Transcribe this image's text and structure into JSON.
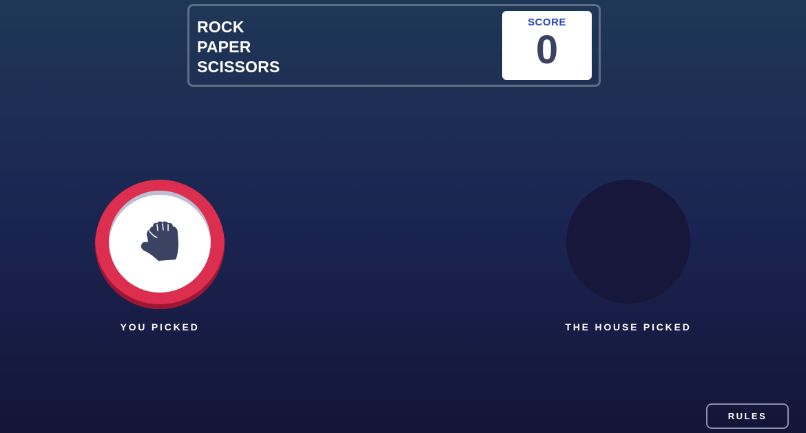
{
  "header": {
    "title_lines": [
      "ROCK",
      "PAPER",
      "SCISSORS"
    ],
    "score_label": "SCORE",
    "score_value": "0"
  },
  "game": {
    "you_picked_label": "YOU PICKED",
    "your_pick_icon": "rock-icon",
    "house_picked_label": "THE HOUSE PICKED"
  },
  "footer": {
    "rules_label": "RULES"
  },
  "colors": {
    "rock_ring": "#dc2e4e",
    "score_label": "#2a46c0",
    "score_value": "#3b4363",
    "background_top": "#1f3757",
    "background_bottom": "#131537"
  }
}
